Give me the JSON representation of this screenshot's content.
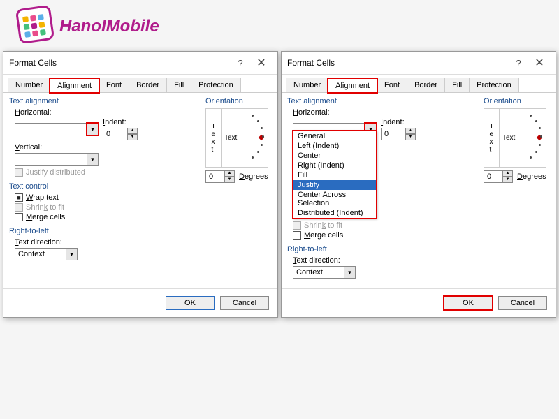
{
  "logo": {
    "brand": "HanoIMobile"
  },
  "tabs": [
    "Number",
    "Alignment",
    "Font",
    "Border",
    "Fill",
    "Protection"
  ],
  "active_tab": "Alignment",
  "dialog_title": "Format Cells",
  "sections": {
    "text_alignment": "Text alignment",
    "text_control": "Text control",
    "rtl": "Right-to-left",
    "orientation": "Orientation"
  },
  "labels": {
    "horizontal": "Horizontal:",
    "vertical": "Vertical:",
    "indent": "Indent:",
    "text_direction": "Text direction:",
    "degrees": "Degrees",
    "text": "Text",
    "vtext": "T\ne\nx\nt"
  },
  "checkboxes": {
    "justify_distributed": "Justify distributed",
    "wrap": "Wrap text",
    "shrink": "Shrink to fit",
    "merge": "Merge cells"
  },
  "buttons": {
    "ok": "OK",
    "cancel": "Cancel",
    "help": "?",
    "close": "✕"
  },
  "left_dialog": {
    "horizontal_value": "",
    "vertical_value": "",
    "indent_value": "0",
    "text_direction_value": "Context",
    "degrees_value": "0",
    "wrap_checked": true
  },
  "right_dialog": {
    "horizontal_value": "",
    "indent_value": "0",
    "text_direction_value": "Context",
    "degrees_value": "0",
    "dropdown_options": [
      "General",
      "Left (Indent)",
      "Center",
      "Right (Indent)",
      "Fill",
      "Justify",
      "Center Across Selection",
      "Distributed (Indent)"
    ],
    "dropdown_selected": "Justify"
  },
  "square_colors": [
    "#f4b400",
    "#e94b8b",
    "#5bb0e8",
    "#44c07c",
    "#b01c8b",
    "#f4b400",
    "#5bb0e8",
    "#e94b8b",
    "#44c07c"
  ]
}
